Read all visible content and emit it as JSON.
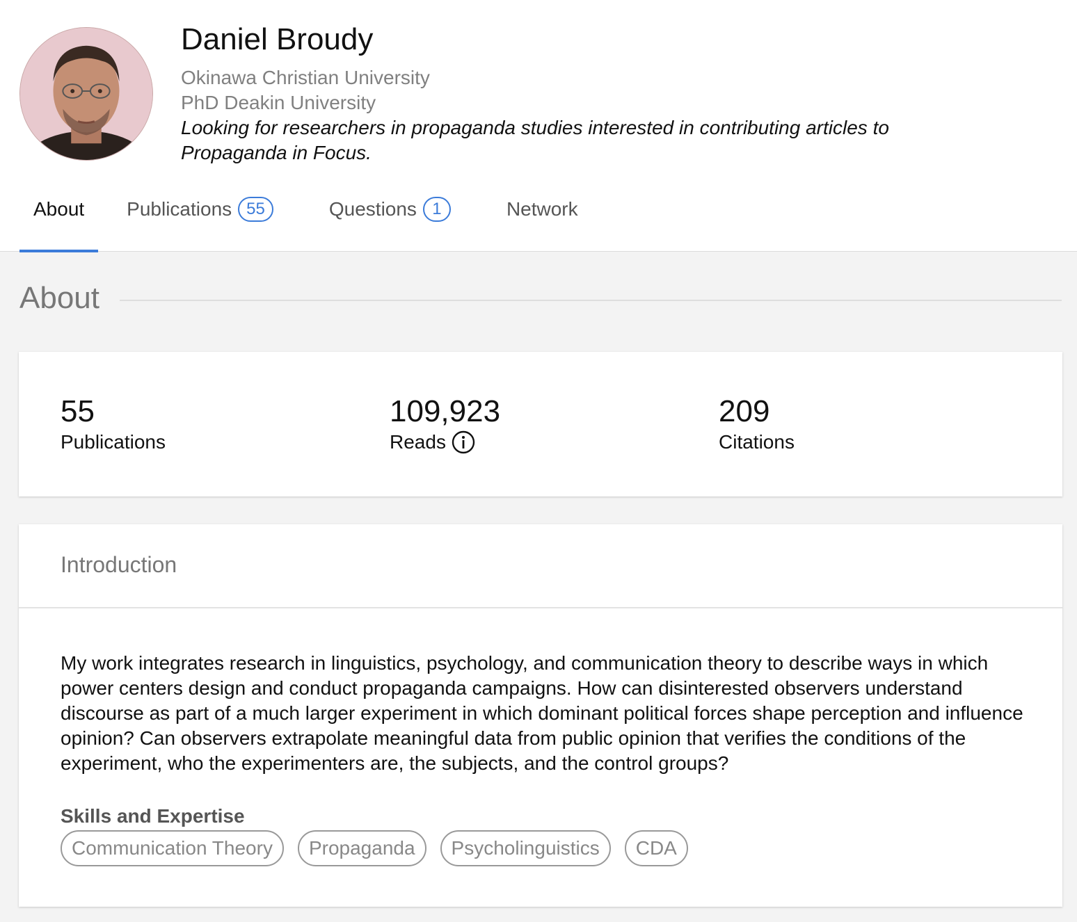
{
  "profile": {
    "name": "Daniel Broudy",
    "affiliation": "Okinawa Christian University",
    "degree": "PhD Deakin University",
    "tagline": "Looking for researchers in propaganda studies interested in contributing articles to Propaganda in Focus."
  },
  "tabs": [
    {
      "label": "About",
      "active": true
    },
    {
      "label": "Publications",
      "badge": "55"
    },
    {
      "label": "Questions",
      "badge": "1"
    },
    {
      "label": "Network"
    }
  ],
  "about": {
    "section_title": "About",
    "stats": {
      "publications": {
        "value": "55",
        "label": "Publications"
      },
      "reads": {
        "value": "109,923",
        "label": "Reads",
        "icon": "info-icon"
      },
      "citations": {
        "value": "209",
        "label": "Citations"
      }
    },
    "introduction": {
      "title": "Introduction",
      "text": "My work integrates research in linguistics, psychology, and communication theory to describe ways in which power centers design and conduct propaganda campaigns. How can disinterested observers understand discourse as part of a much larger experiment in which dominant political forces shape perception and influence opinion? Can observers extrapolate meaningful data from public opinion that verifies the conditions of the experiment, who the experimenters are, the subjects, and the control groups?"
    },
    "skills_title": "Skills and Expertise",
    "skills": [
      "Communication Theory",
      "Propaganda",
      "Psycholinguistics",
      "CDA"
    ]
  },
  "colors": {
    "accent": "#3b7bd9",
    "page_background": "#f3f3f3",
    "muted_text": "#808080"
  }
}
